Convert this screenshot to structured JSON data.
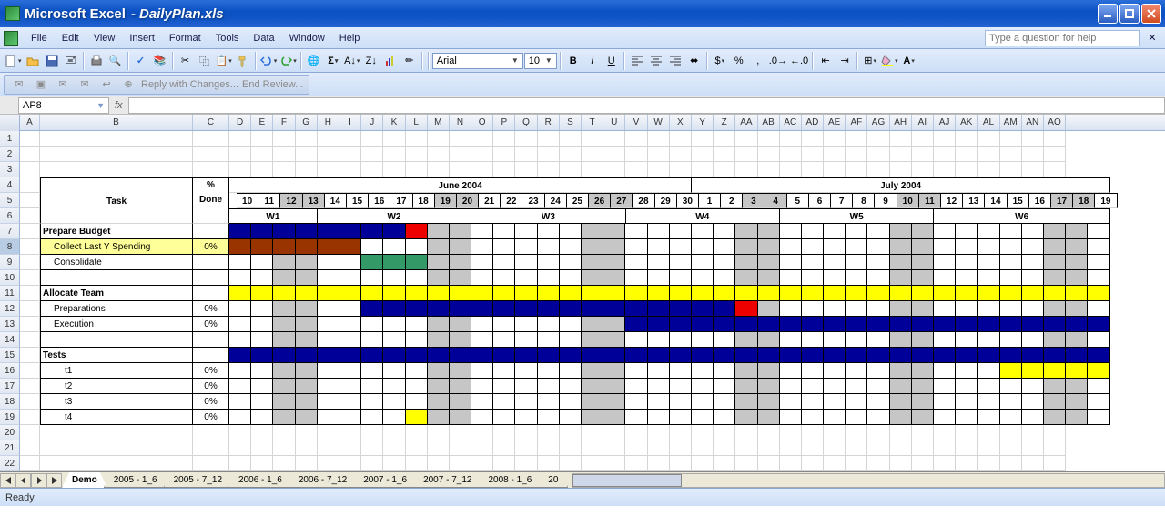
{
  "app": {
    "name": "Microsoft Excel",
    "file": "DailyPlan.xls"
  },
  "menu": [
    "File",
    "Edit",
    "View",
    "Insert",
    "Format",
    "Tools",
    "Data",
    "Window",
    "Help"
  ],
  "help_placeholder": "Type a question for help",
  "font": {
    "name": "Arial",
    "size": "10"
  },
  "collab": {
    "reply": "Reply with Changes...",
    "end": "End Review..."
  },
  "namebox": "AP8",
  "status": "Ready",
  "sheet_tabs": [
    "Demo",
    "2005 - 1_6",
    "2005 - 7_12",
    "2006 - 1_6",
    "2006 - 7_12",
    "2007 - 1_6",
    "2007 - 7_12",
    "2008 - 1_6",
    "20"
  ],
  "col_widths": {
    "A": 22,
    "B": 168,
    "C": 40
  },
  "day_col_width": 24.2,
  "columns": [
    "A",
    "B",
    "C",
    "D",
    "E",
    "F",
    "G",
    "H",
    "I",
    "J",
    "K",
    "L",
    "M",
    "N",
    "O",
    "P",
    "Q",
    "R",
    "S",
    "T",
    "U",
    "V",
    "W",
    "X",
    "Y",
    "Z",
    "AA",
    "AB",
    "AC",
    "AD",
    "AE",
    "AF",
    "AG",
    "AH",
    "AI",
    "AJ",
    "AK",
    "AL",
    "AM",
    "AN",
    "AO"
  ],
  "plan": {
    "months": [
      {
        "label": "June 2004",
        "span": 21
      },
      {
        "label": "July 2004",
        "span": 19
      }
    ],
    "days": [
      "10",
      "11",
      "12",
      "13",
      "14",
      "15",
      "16",
      "17",
      "18",
      "19",
      "20",
      "21",
      "22",
      "23",
      "24",
      "25",
      "26",
      "27",
      "28",
      "29",
      "30",
      "1",
      "2",
      "3",
      "4",
      "5",
      "6",
      "7",
      "8",
      "9",
      "10",
      "11",
      "12",
      "13",
      "14",
      "15",
      "16",
      "17",
      "18",
      "19"
    ],
    "weeks": [
      {
        "label": "W1",
        "span": 4
      },
      {
        "label": "W2",
        "span": 7
      },
      {
        "label": "W3",
        "span": 7
      },
      {
        "label": "W4",
        "span": 7
      },
      {
        "label": "W5",
        "span": 7
      },
      {
        "label": "W6",
        "span": 8
      }
    ],
    "weekend_cols": [
      2,
      3,
      9,
      10,
      16,
      17,
      23,
      24,
      30,
      31,
      37,
      38
    ],
    "task_header": "Task",
    "done_header": "% Done",
    "rows": [
      {
        "n": 7,
        "label": "Prepare Budget",
        "bold": true,
        "done": "",
        "bars": [
          {
            "c": "blue",
            "s": 0,
            "e": 8
          },
          {
            "c": "red",
            "s": 8,
            "e": 9
          }
        ]
      },
      {
        "n": 8,
        "label": "Collect Last Y Spending",
        "indent": 1,
        "done": "0%",
        "bars": [
          {
            "c": "brown",
            "s": 0,
            "e": 6
          }
        ],
        "selrow": true,
        "yellow": true
      },
      {
        "n": 9,
        "label": "Consolidate",
        "indent": 1,
        "done": "",
        "bars": [
          {
            "c": "green",
            "s": 6,
            "e": 9
          }
        ]
      },
      {
        "n": 10,
        "label": "",
        "done": "",
        "bars": []
      },
      {
        "n": 11,
        "label": "Allocate Team",
        "bold": true,
        "done": "",
        "bars": [
          {
            "c": "yellow",
            "s": 0,
            "e": 40
          }
        ]
      },
      {
        "n": 12,
        "label": "Preparations",
        "indent": 1,
        "done": "0%",
        "bars": [
          {
            "c": "blue",
            "s": 6,
            "e": 23
          },
          {
            "c": "red",
            "s": 23,
            "e": 24
          }
        ]
      },
      {
        "n": 13,
        "label": "Execution",
        "indent": 1,
        "done": "0%",
        "bars": [
          {
            "c": "blue",
            "s": 18,
            "e": 40
          }
        ]
      },
      {
        "n": 14,
        "label": "",
        "done": "",
        "bars": []
      },
      {
        "n": 15,
        "label": "Tests",
        "bold": true,
        "done": "",
        "bars": [
          {
            "c": "blue",
            "s": 0,
            "e": 40
          }
        ]
      },
      {
        "n": 16,
        "label": "t1",
        "indent": 2,
        "done": "0%",
        "bars": [
          {
            "c": "yellow",
            "s": 35,
            "e": 40
          }
        ]
      },
      {
        "n": 17,
        "label": "t2",
        "indent": 2,
        "done": "0%",
        "bars": []
      },
      {
        "n": 18,
        "label": "t3",
        "indent": 2,
        "done": "0%",
        "bars": []
      },
      {
        "n": 19,
        "label": "t4",
        "indent": 2,
        "done": "0%",
        "bars": [
          {
            "c": "yellow",
            "s": 8,
            "e": 9
          }
        ]
      }
    ]
  }
}
